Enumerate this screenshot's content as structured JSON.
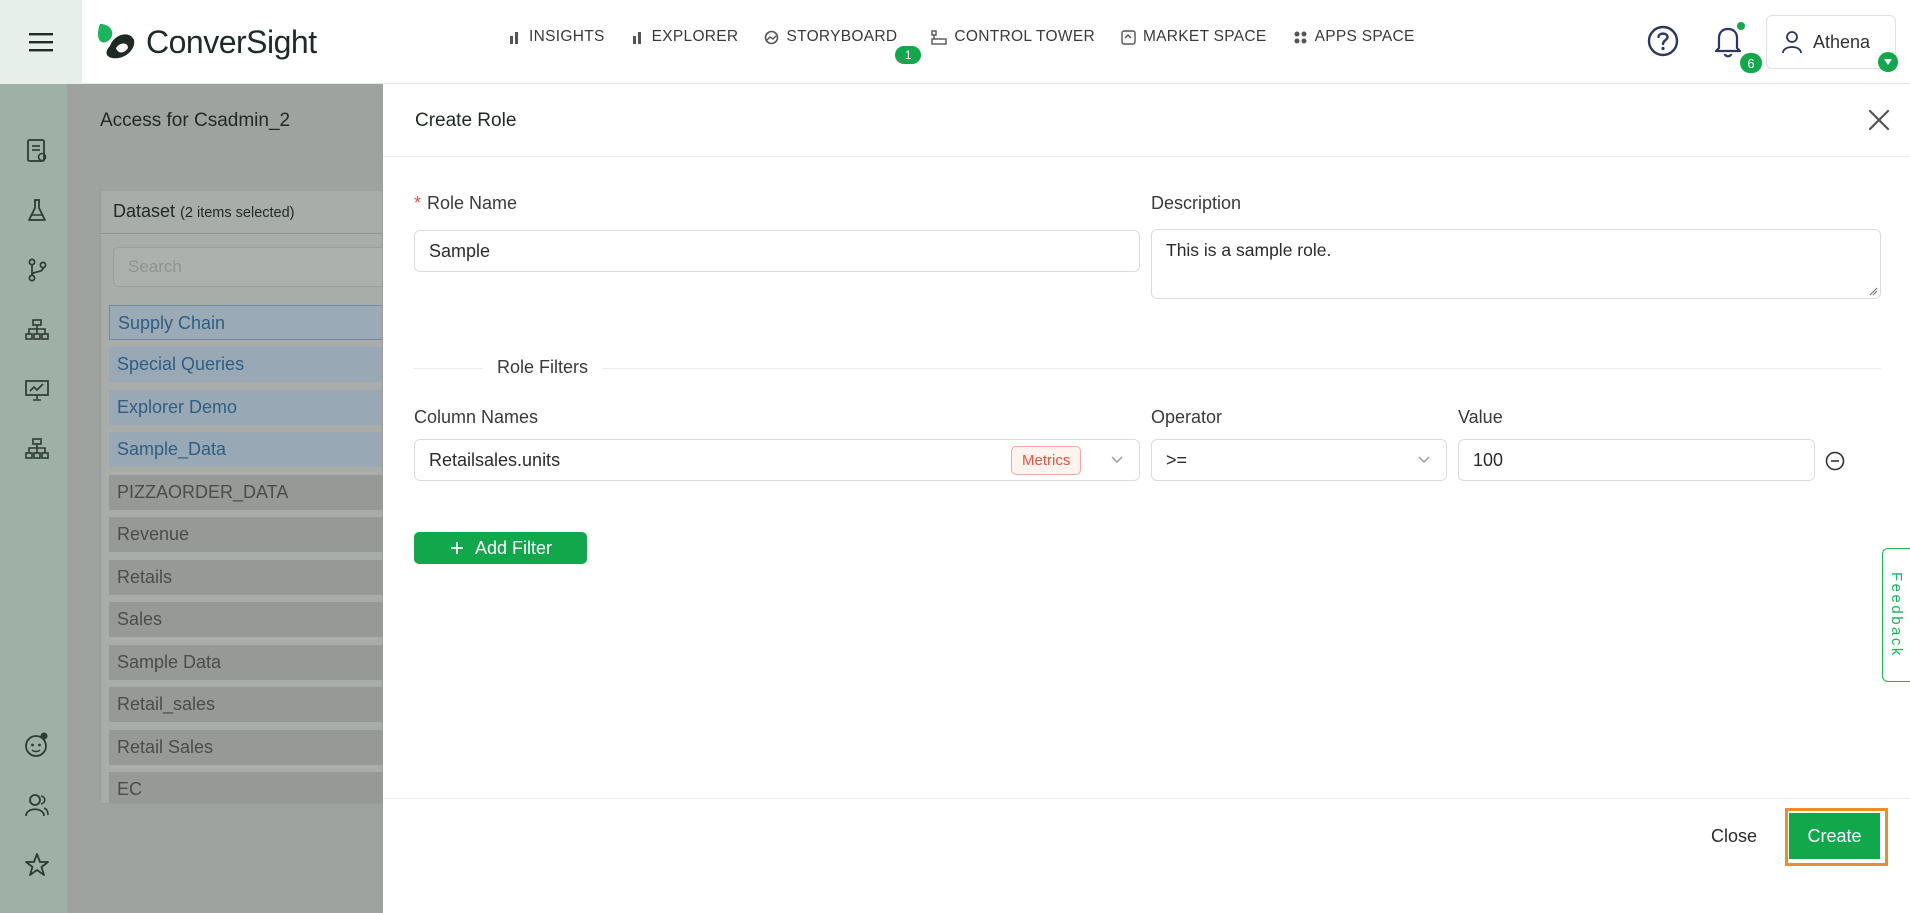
{
  "app": {
    "brand": "ConverSight",
    "brand_colors": {
      "green": "#11a84b",
      "orange_highlight": "#f08a2c"
    }
  },
  "topnav": {
    "items": [
      {
        "label": "INSIGHTS",
        "icon": "bar-chart-icon"
      },
      {
        "label": "EXPLORER",
        "icon": "bar-chart-icon"
      },
      {
        "label": "STORYBOARD",
        "icon": "storyboard-icon",
        "badge": "1"
      },
      {
        "label": "CONTROL TOWER",
        "icon": "control-tower-icon"
      },
      {
        "label": "MARKET SPACE",
        "icon": "market-space-icon"
      },
      {
        "label": "APPS SPACE",
        "icon": "apps-grid-icon"
      }
    ],
    "notifications_count": "6",
    "user_name": "Athena"
  },
  "sidebar": {
    "icons": [
      "document-icon",
      "flask-icon",
      "branch-icon",
      "hierarchy-icon",
      "presentation-chart-icon",
      "hierarchy-icon",
      "bot-icon",
      "users-icon",
      "star-icon"
    ]
  },
  "background_page": {
    "title": "Access for Csadmin_2",
    "dataset_panel": {
      "heading": "Dataset",
      "selection_note": "(2 items selected)",
      "search_placeholder": "Search",
      "items": [
        {
          "label": "Supply Chain",
          "selected": true
        },
        {
          "label": "Special Queries",
          "selected": true
        },
        {
          "label": "Explorer Demo",
          "selected": true
        },
        {
          "label": "Sample_Data",
          "selected": true
        },
        {
          "label": "PIZZAORDER_DATA",
          "selected": false
        },
        {
          "label": "Revenue",
          "selected": false
        },
        {
          "label": "Retails",
          "selected": false
        },
        {
          "label": "Sales",
          "selected": false
        },
        {
          "label": "Sample Data",
          "selected": false
        },
        {
          "label": "Retail_sales",
          "selected": false
        },
        {
          "label": "Retail Sales",
          "selected": false
        },
        {
          "label": "EC",
          "selected": false
        }
      ]
    }
  },
  "drawer": {
    "title": "Create Role",
    "role_name": {
      "label": "Role Name",
      "required_mark": "*",
      "value": "Sample"
    },
    "description": {
      "label": "Description",
      "value": "This is a sample role."
    },
    "filters_section_title": "Role Filters",
    "filter_columns": {
      "column_names": "Column Names",
      "operator": "Operator",
      "value": "Value"
    },
    "filter_rows": [
      {
        "column": "Retailsales.units",
        "tag": "Metrics",
        "operator": ">=",
        "value": "100"
      }
    ],
    "add_filter_label": "Add Filter",
    "footer": {
      "close_label": "Close",
      "create_label": "Create"
    }
  },
  "feedback_tab": "Feedback"
}
